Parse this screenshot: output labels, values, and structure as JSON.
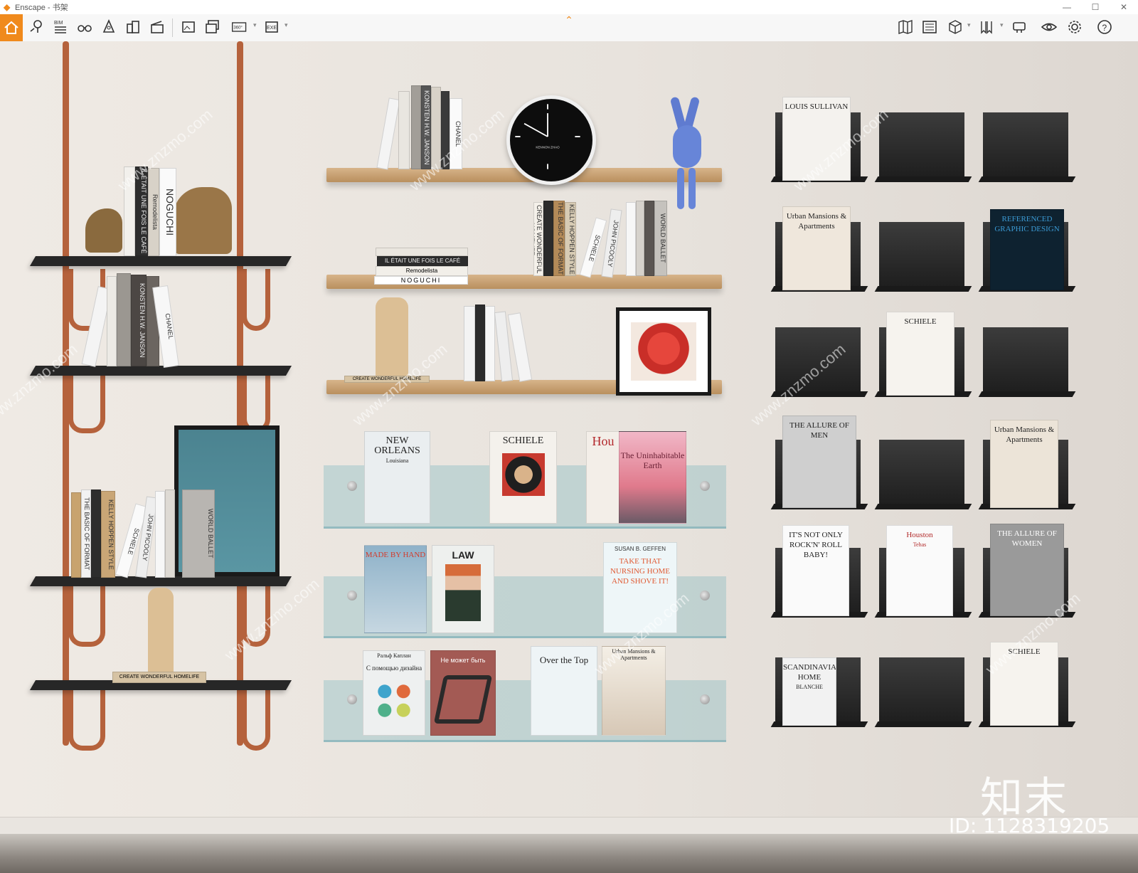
{
  "window": {
    "title": "Enscape - 书架",
    "controls": [
      "—",
      "☐",
      "✕"
    ]
  },
  "toolbar": {
    "home_icon": "home-icon",
    "bim_label": "BIM",
    "pano_label": "360°",
    "exe_label": "EXE",
    "collapse_icon": "chevron-up-icon",
    "accent_color": "#f08a1c"
  },
  "scene": {
    "watermark_text": "www.znzmo.com",
    "brand_logo": "知末",
    "image_id": "ID: 1128319205",
    "left_shelf_books": [
      "IL ÉTAIT UNE FOIS LE CAFÉ",
      "Remodelista",
      "NOGUCHI",
      "KONSTEN H.W. JANSON",
      "CHANEL",
      "THE BASIC OF FORMAT",
      "KELLY HOPPEN STYLE",
      "SCHIELE",
      "JOHN PICOOLY",
      "WORLD BALLET",
      "CREATE WONDERFUL HOMELIFE"
    ],
    "wood_shelf_books": [
      "CHANEL",
      "KONSTEN H.W. JANSON",
      "Remodelista",
      "NOGUCHI",
      "IL ÉTAIT UNE FOIS LE CAFÉ",
      "CREATE WONDERFUL HOMELIFE",
      "THE BASIC OF FORMAT",
      "KELLY HOPPEN STYLE",
      "SCHIELE",
      "JOHN PICOOLY",
      "WORLD BALLET",
      "CREATE WONDERFUL HOMELIFE"
    ],
    "clock_brand": "KENNON ZHAO",
    "glass_row1": [
      {
        "title": "NEW ORLEANS",
        "sub": "Louisiana"
      },
      {
        "title": "SCHIELE",
        "sub": ""
      },
      {
        "title": "Hou",
        "sub": ""
      },
      {
        "title": "The Uninhabitable Earth",
        "sub": ""
      }
    ],
    "glass_row2": [
      {
        "title": "MADE BY HAND",
        "sub": ""
      },
      {
        "title": "LAW",
        "sub": ""
      },
      {
        "title": "SUSAN B. GEFFEN",
        "sub": "TAKE THAT NURSING HOME AND SHOVE IT!"
      }
    ],
    "glass_row3": [
      {
        "title": "С помощью дизайна",
        "sub": "Ральф Каплан"
      },
      {
        "title": "Не может быть",
        "sub": ""
      },
      {
        "title": "Over the Top",
        "sub": ""
      },
      {
        "title": "Urban Mansions & Apartments",
        "sub": ""
      }
    ],
    "right_grid": [
      {
        "title": "LOUIS SULLIVAN",
        "sub": ""
      },
      {
        "title": "",
        "sub": ""
      },
      {
        "title": "",
        "sub": ""
      },
      {
        "title": "Urban Mansions & Apartments",
        "sub": ""
      },
      {
        "title": "",
        "sub": ""
      },
      {
        "title": "REFERENCED GRAPHIC DESIGN",
        "sub": ""
      },
      {
        "title": "",
        "sub": ""
      },
      {
        "title": "SCHIELE",
        "sub": ""
      },
      {
        "title": "",
        "sub": ""
      },
      {
        "title": "THE ALLURE OF MEN",
        "sub": ""
      },
      {
        "title": "",
        "sub": ""
      },
      {
        "title": "Urban Mansions & Apartments",
        "sub": ""
      },
      {
        "title": "IT'S NOT ONLY ROCK'N' ROLL BABY!",
        "sub": ""
      },
      {
        "title": "Houston",
        "sub": "Tehas"
      },
      {
        "title": "THE ALLURE OF WOMEN",
        "sub": ""
      },
      {
        "title": "SCANDINAVIAN HOME",
        "sub": "BLANCHE"
      },
      {
        "title": "",
        "sub": ""
      },
      {
        "title": "SCHIELE",
        "sub": ""
      }
    ]
  }
}
